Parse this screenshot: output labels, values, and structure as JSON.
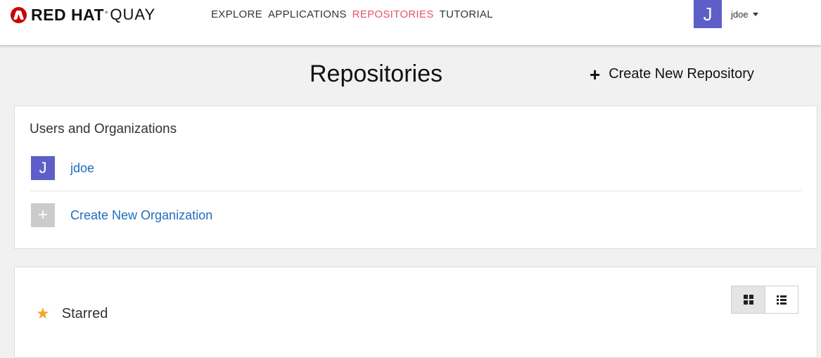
{
  "brand": {
    "red": "RED HAT",
    "deg": "°",
    "product": "QUAY"
  },
  "nav": [
    {
      "label": "EXPLORE",
      "active": false
    },
    {
      "label": "APPLICATIONS",
      "active": false
    },
    {
      "label": "REPOSITORIES",
      "active": true
    },
    {
      "label": "TUTORIAL",
      "active": false
    }
  ],
  "user": {
    "initial": "J",
    "name": "jdoe"
  },
  "header": {
    "title": "Repositories",
    "create_repo_label": "Create New Repository"
  },
  "users_orgs": {
    "heading": "Users and Organizations",
    "items": [
      {
        "avatar": "J",
        "label": "jdoe"
      },
      {
        "avatar": "+",
        "label": "Create New Organization"
      }
    ]
  },
  "starred": {
    "label": "Starred",
    "view_modes": [
      "grid",
      "list"
    ],
    "active_view": "grid"
  },
  "colors": {
    "accent": "#e4566a",
    "avatar": "#5e5ec9",
    "link": "#1f6dbf",
    "star": "#f6a623"
  }
}
